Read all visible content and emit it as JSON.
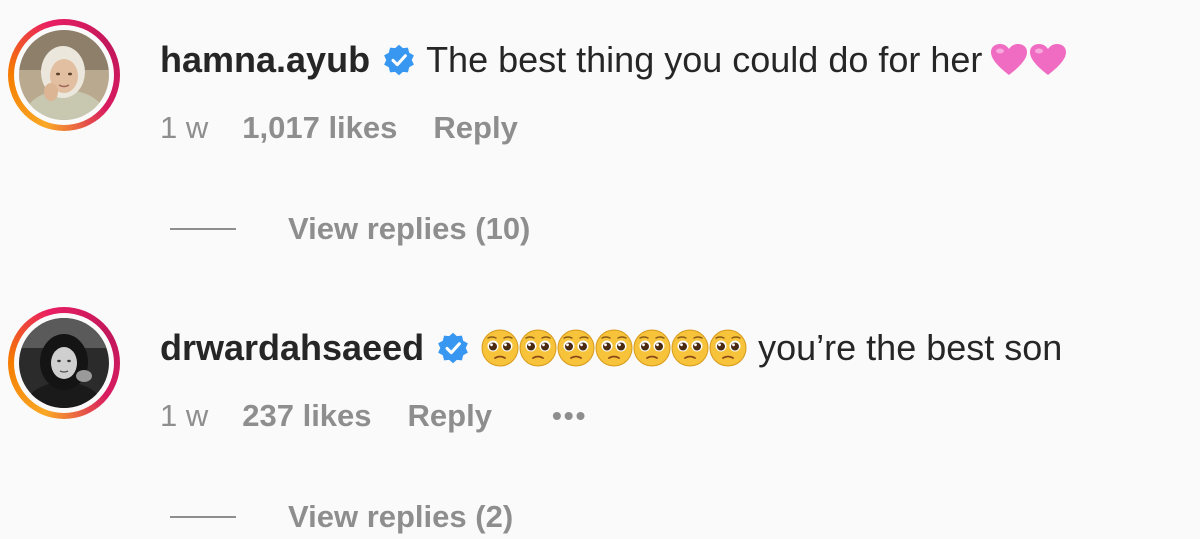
{
  "comments": [
    {
      "username": "hamna.ayub",
      "verified": true,
      "text": "The best thing you could do for her",
      "trailing_emoji": "pink-hearts",
      "time": "1 w",
      "likes": "1,017 likes",
      "reply_label": "Reply",
      "view_replies": "View replies (10)",
      "avatar_icon": "avatar-woman-photo"
    },
    {
      "username": "drwardahsaeed",
      "verified": true,
      "leading_emoji": "pleading-face",
      "leading_emoji_count": 7,
      "text": "you’re the best son",
      "time": "1 w",
      "likes": "237 likes",
      "reply_label": "Reply",
      "more_label": "•••",
      "view_replies": "View replies (2)",
      "avatar_icon": "avatar-woman-photo-bw"
    }
  ],
  "colors": {
    "username": "#262626",
    "meta": "#8e8e8e",
    "verified": "#3897f0",
    "background": "#fafafa",
    "heart": "#f06bc2"
  }
}
